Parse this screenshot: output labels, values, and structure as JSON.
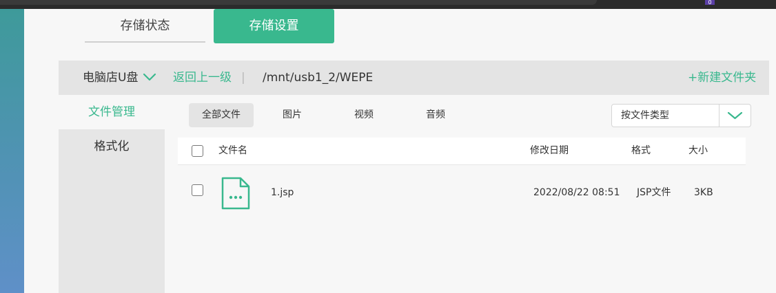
{
  "tabs": {
    "status_label": "存储状态",
    "settings_label": "存储设置"
  },
  "pathbar": {
    "drive_label": "电脑店U盘",
    "back_label": "返回上一级",
    "separator": "|",
    "current_path": "/mnt/usb1_2/WEPE",
    "new_folder_label": "+新建文件夹"
  },
  "sidenav": {
    "file_manage_label": "文件管理",
    "format_label": "格式化"
  },
  "filters": {
    "all": "全部文件",
    "images": "图片",
    "videos": "视频",
    "audio": "音频"
  },
  "type_select": {
    "value": "按文件类型"
  },
  "table": {
    "headers": {
      "name": "文件名",
      "date": "修改日期",
      "format": "格式",
      "size": "大小"
    },
    "rows": [
      {
        "name": "1.jsp",
        "date": "2022/08/22 08:51",
        "format": "JSP文件",
        "size": "3KB"
      }
    ]
  },
  "topbar": {
    "badge": "0"
  },
  "colors": {
    "accent": "#39b88e",
    "path_bg": "#e4e4e4",
    "page_bg": "#f7f7f7"
  },
  "icons": {
    "drive_caret": "chevron-down-icon",
    "select_caret": "chevron-down-icon",
    "file": "file-dots-icon"
  }
}
